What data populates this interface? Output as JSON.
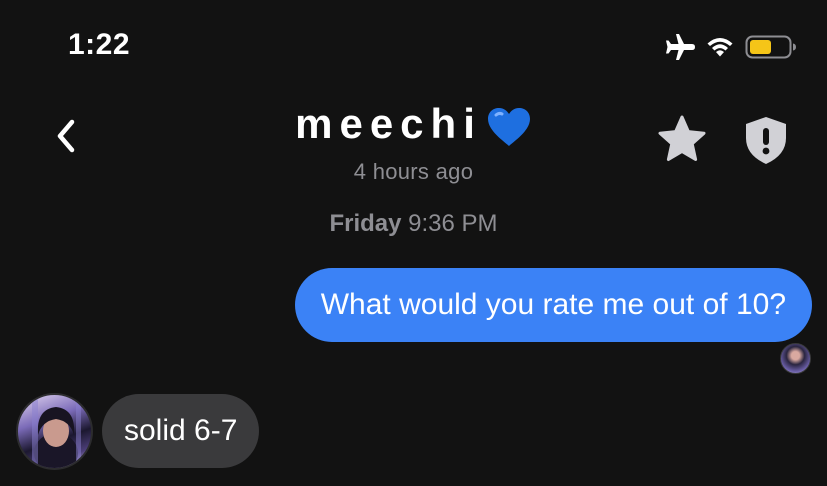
{
  "status_bar": {
    "time": "1:22",
    "icons": [
      "airplane-mode-icon",
      "wifi-icon",
      "battery-icon"
    ],
    "battery_color": "#f5c518"
  },
  "header": {
    "contact_name": "meechi",
    "heart_emoji": "💙",
    "last_seen": "4 hours ago",
    "icons": [
      "back-chevron-icon",
      "star-icon",
      "shield-alert-icon"
    ]
  },
  "conversation": {
    "date_divider": {
      "day": "Friday",
      "time": "9:36 PM"
    },
    "messages": [
      {
        "direction": "outgoing",
        "text": "What would you rate me out of 10?",
        "bubble_color": "#3b82f6"
      },
      {
        "direction": "incoming",
        "text": "solid 6-7",
        "bubble_color": "#3a3a3c"
      }
    ]
  },
  "colors": {
    "background": "#121212",
    "secondary_text": "#8e8e93",
    "icon_fill": "#d1d1d6"
  }
}
